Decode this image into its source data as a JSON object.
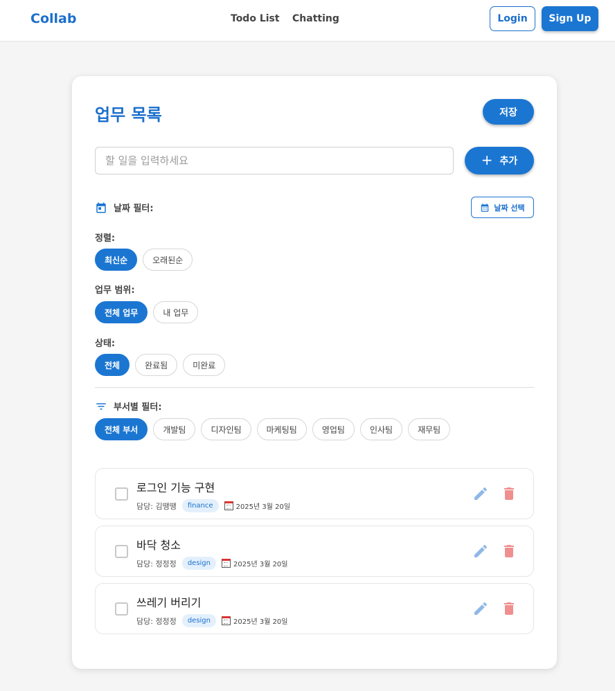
{
  "header": {
    "brand": "Collab",
    "nav": [
      "Todo List",
      "Chatting"
    ],
    "login_label": "Login",
    "signup_label": "Sign Up"
  },
  "main": {
    "title": "업무 목록",
    "save_label": "저장",
    "input_placeholder": "할 일을 입력하세요",
    "input_value": "",
    "add_label": "추가",
    "date_filter_label": "날짜 필터:",
    "date_select_label": "날짜 선택",
    "sort": {
      "label": "정렬:",
      "options": [
        "최신순",
        "오래된순"
      ],
      "selected": "최신순"
    },
    "scope": {
      "label": "업무 범위:",
      "options": [
        "전체 업무",
        "내 업무"
      ],
      "selected": "전체 업무"
    },
    "status": {
      "label": "상태:",
      "options": [
        "전체",
        "완료됨",
        "미완료"
      ],
      "selected": "전체"
    },
    "department": {
      "label": "부서별 필터:",
      "options": [
        "전체 부서",
        "개발팀",
        "디자인팀",
        "마케팅팀",
        "영업팀",
        "인사팀",
        "재무팀"
      ],
      "selected": "전체 부서"
    },
    "todos": [
      {
        "title": "로그인 기능 구현",
        "assignee": "담당: 김땡땡",
        "department": "finance",
        "date": "2025년 3월 20일",
        "done": false
      },
      {
        "title": "바닥 청소",
        "assignee": "담당: 정정정",
        "department": "design",
        "date": "2025년 3월 20일",
        "done": false
      },
      {
        "title": "쓰레기 버리기",
        "assignee": "담당: 정정정",
        "department": "design",
        "date": "2025년 3월 20일",
        "done": false
      }
    ]
  },
  "colors": {
    "primary": "#1b76d2",
    "edit_icon": "#8fb8e8",
    "delete_icon": "#ef8f8f",
    "tag_bg": "#e3f0fc"
  }
}
